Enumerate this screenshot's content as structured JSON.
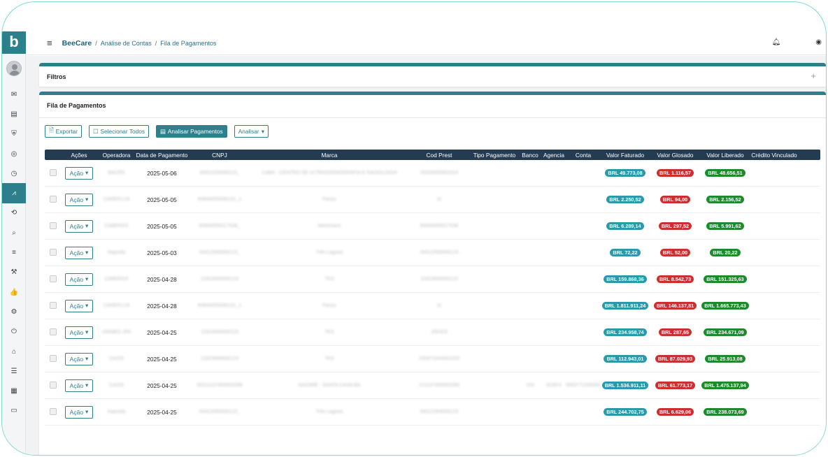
{
  "brand": {
    "logo_letter": "b",
    "accent": "#2e7f8c"
  },
  "breadcrumb": {
    "brand": "BeeCare",
    "sep": "/",
    "items": [
      "Análise de Contas",
      "Fila de Pagamentos"
    ]
  },
  "filters": {
    "title": "Filtros",
    "expand": "+"
  },
  "queue": {
    "title": "Fila de Pagamentos",
    "toolbar": {
      "export": "Exportar",
      "select_all": "Selecionar Todos",
      "analyze_payments": "Analisar Pagamentos",
      "analyze": "Analisar"
    },
    "columns": [
      "",
      "Ações",
      "Operadora",
      "Data de Pagamento",
      "CNPJ",
      "Marca",
      "Cod Prest",
      "Tipo Pagamento",
      "Banco",
      "Agencia",
      "Conta",
      "Valor Faturado",
      "Valor Glosado",
      "Valor Liberado",
      "Crédito Vinculado"
    ],
    "action_label": "Ação",
    "rows": [
      {
        "operadora": "BACEN",
        "data": "2025-05-06",
        "cnpj": "40911020000115_",
        "marca": "CABA - CENTRO DE ULTRASSONOGRAFIA E RADIOLOGIA",
        "cod": "28320820001024",
        "banco": "",
        "agencia": "",
        "conta": "",
        "vf": "BRL 49.773,08",
        "vg": "BRL 1.116,57",
        "vl": "BRL 48.656,51"
      },
      {
        "operadora": "CAREPLUS",
        "data": "2025-05-05",
        "cnpj": "60840055000131_1",
        "marca": "Fleury",
        "cod": "11",
        "banco": "",
        "agencia": "",
        "conta": "",
        "vf": "BRL 2.250,52",
        "vg": "BRL 94,00",
        "vl": "BRL 2.156,52"
      },
      {
        "operadora": "CABERGS",
        "data": "2025-05-05",
        "cnpj": "60840055017538_",
        "marca": "Weinmann",
        "cod": "60840055017538",
        "banco": "",
        "agencia": "",
        "conta": "",
        "vf": "BRL 6.289,14",
        "vg": "BRL 297,52",
        "vl": "BRL 5.991,62"
      },
      {
        "operadora": "Hapvida",
        "data": "2025-05-03",
        "cnpj": "04312093000123_",
        "marca": "Três Lagoas",
        "cod": "04312093000123",
        "banco": "",
        "agencia": "",
        "conta": "",
        "vf": "BRL 72,22",
        "vg": "BRL 52,00",
        "vl": "BRL 20,22"
      },
      {
        "operadora": "CABERGS",
        "data": "2025-04-28",
        "cnpj": "11923840000123",
        "marca": "TKS",
        "cod": "11923840000123",
        "banco": "",
        "agencia": "",
        "conta": "",
        "vf": "BRL 159.868,36",
        "vg": "BRL 8.542,73",
        "vl": "BRL 151.325,63"
      },
      {
        "operadora": "CAREPLUS",
        "data": "2025-04-28",
        "cnpj": "60840055000131_1",
        "marca": "Fleury",
        "cod": "11",
        "banco": "",
        "agencia": "",
        "conta": "",
        "vf": "BRL 1.811.911,24",
        "vg": "BRL 146.137,81",
        "vl": "BRL 1.665.773,43"
      },
      {
        "operadora": "UNIMED JPA",
        "data": "2025-04-25",
        "cnpj": "11923840000123",
        "marca": "TKS",
        "cod": "200323",
        "banco": "",
        "agencia": "",
        "conta": "",
        "vf": "BRL 234.958,74",
        "vg": "BRL 287,65",
        "vl": "BRL 234.671,09"
      },
      {
        "operadora": "CASSI",
        "data": "2025-04-25",
        "cnpj": "11923840000123",
        "marca": "TKS",
        "cod": "230971044001020",
        "banco": "",
        "agencia": "",
        "conta": "",
        "vf": "BRL 112.943,01",
        "vg": "BRL 87.029,93",
        "vl": "BRL 25.913,08"
      },
      {
        "operadora": "CASSI",
        "data": "2025-04-25",
        "cnpj": "00211137450002099",
        "marca": "NAZARE - SANTA CASA BA",
        "cod": "211137450002099",
        "banco": "104",
        "agencia": "0239-0",
        "conta": "0003772200402-3",
        "vf": "BRL 1.536.911,11",
        "vg": "BRL 61.773,17",
        "vl": "BRL 1.475.137,94"
      },
      {
        "operadora": "Hapvida",
        "data": "2025-04-25",
        "cnpj": "04312093000123_",
        "marca": "Três Lagoas",
        "cod": "04312093000123",
        "banco": "",
        "agencia": "",
        "conta": "",
        "vf": "BRL 244.702,75",
        "vg": "BRL 6.629,06",
        "vl": "BRL 238.073,69"
      }
    ]
  }
}
